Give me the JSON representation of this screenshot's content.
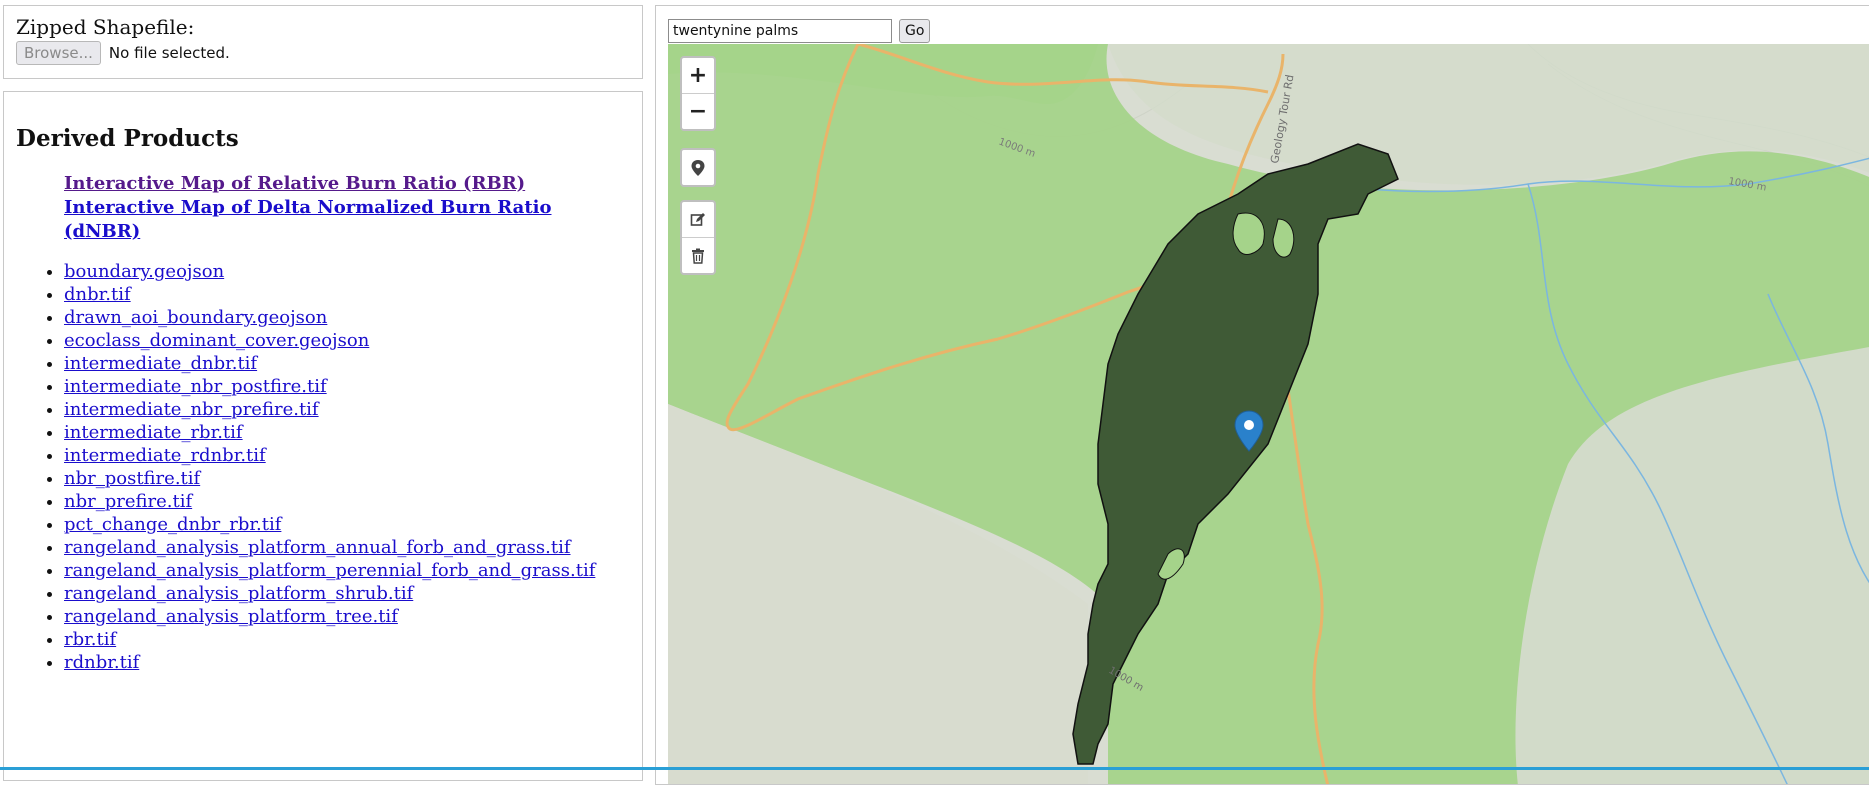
{
  "upload": {
    "label": "Zipped Shapefile:",
    "browse_label": "Browse...",
    "file_status": "No file selected."
  },
  "products": {
    "heading": "Derived Products",
    "featured": [
      {
        "label": "Interactive Map of Relative Burn Ratio (RBR)",
        "visited": true
      },
      {
        "label": "Interactive Map of Delta Normalized Burn Ratio (dNBR)",
        "visited": false
      }
    ],
    "files": [
      "boundary.geojson",
      "dnbr.tif",
      "drawn_aoi_boundary.geojson",
      "ecoclass_dominant_cover.geojson",
      "intermediate_dnbr.tif",
      "intermediate_nbr_postfire.tif",
      "intermediate_nbr_prefire.tif",
      "intermediate_rbr.tif",
      "intermediate_rdnbr.tif",
      "nbr_postfire.tif",
      "nbr_prefire.tif",
      "pct_change_dnbr_rbr.tif",
      "rangeland_analysis_platform_annual_forb_and_grass.tif",
      "rangeland_analysis_platform_perennial_forb_and_grass.tif",
      "rangeland_analysis_platform_shrub.tif",
      "rangeland_analysis_platform_tree.tif",
      "rbr.tif",
      "rdnbr.tif"
    ]
  },
  "map": {
    "search_value": "twentynine palms",
    "go_label": "Go",
    "controls": {
      "zoom_in": "+",
      "zoom_out": "−"
    },
    "labels": {
      "road": "Geology Tour Rd",
      "contour_1": "1000 m",
      "contour_2": "1000 m",
      "contour_3": "1000 m"
    },
    "colors": {
      "burn_fill": "#3f5a36",
      "park_green": "#a5d38a",
      "terrain": "#d9ddd2",
      "road": "#e9b46a",
      "stream": "#7bb6e0",
      "marker": "#2a81cb"
    },
    "icons": {
      "locate": "map-pin-icon",
      "draw": "edit-icon",
      "delete": "trash-icon",
      "marker": "map-marker-icon"
    }
  }
}
